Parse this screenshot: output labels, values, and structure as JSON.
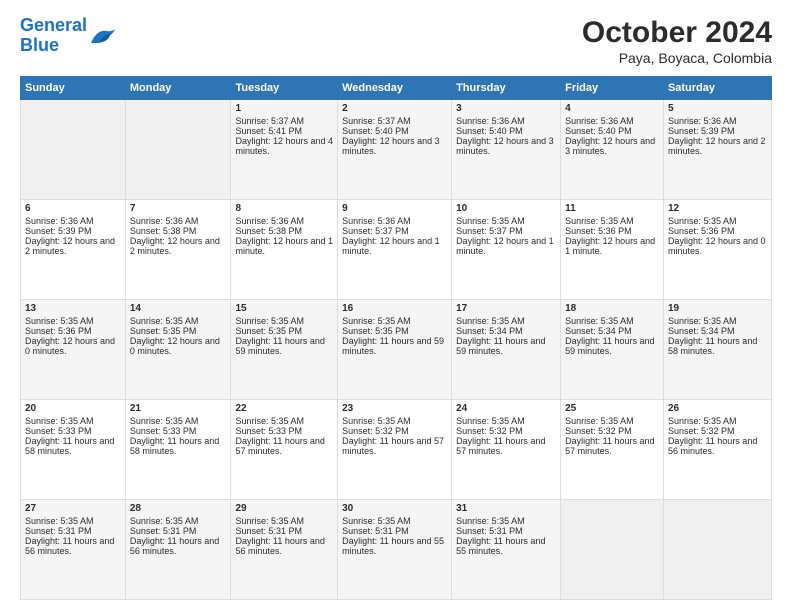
{
  "header": {
    "logo_line1": "General",
    "logo_line2": "Blue",
    "title": "October 2024",
    "subtitle": "Paya, Boyaca, Colombia"
  },
  "days_of_week": [
    "Sunday",
    "Monday",
    "Tuesday",
    "Wednesday",
    "Thursday",
    "Friday",
    "Saturday"
  ],
  "weeks": [
    [
      {
        "day": "",
        "sunrise": "",
        "sunset": "",
        "daylight": ""
      },
      {
        "day": "",
        "sunrise": "",
        "sunset": "",
        "daylight": ""
      },
      {
        "day": "1",
        "sunrise": "Sunrise: 5:37 AM",
        "sunset": "Sunset: 5:41 PM",
        "daylight": "Daylight: 12 hours and 4 minutes."
      },
      {
        "day": "2",
        "sunrise": "Sunrise: 5:37 AM",
        "sunset": "Sunset: 5:40 PM",
        "daylight": "Daylight: 12 hours and 3 minutes."
      },
      {
        "day": "3",
        "sunrise": "Sunrise: 5:36 AM",
        "sunset": "Sunset: 5:40 PM",
        "daylight": "Daylight: 12 hours and 3 minutes."
      },
      {
        "day": "4",
        "sunrise": "Sunrise: 5:36 AM",
        "sunset": "Sunset: 5:40 PM",
        "daylight": "Daylight: 12 hours and 3 minutes."
      },
      {
        "day": "5",
        "sunrise": "Sunrise: 5:36 AM",
        "sunset": "Sunset: 5:39 PM",
        "daylight": "Daylight: 12 hours and 2 minutes."
      }
    ],
    [
      {
        "day": "6",
        "sunrise": "Sunrise: 5:36 AM",
        "sunset": "Sunset: 5:39 PM",
        "daylight": "Daylight: 12 hours and 2 minutes."
      },
      {
        "day": "7",
        "sunrise": "Sunrise: 5:36 AM",
        "sunset": "Sunset: 5:38 PM",
        "daylight": "Daylight: 12 hours and 2 minutes."
      },
      {
        "day": "8",
        "sunrise": "Sunrise: 5:36 AM",
        "sunset": "Sunset: 5:38 PM",
        "daylight": "Daylight: 12 hours and 1 minute."
      },
      {
        "day": "9",
        "sunrise": "Sunrise: 5:36 AM",
        "sunset": "Sunset: 5:37 PM",
        "daylight": "Daylight: 12 hours and 1 minute."
      },
      {
        "day": "10",
        "sunrise": "Sunrise: 5:35 AM",
        "sunset": "Sunset: 5:37 PM",
        "daylight": "Daylight: 12 hours and 1 minute."
      },
      {
        "day": "11",
        "sunrise": "Sunrise: 5:35 AM",
        "sunset": "Sunset: 5:36 PM",
        "daylight": "Daylight: 12 hours and 1 minute."
      },
      {
        "day": "12",
        "sunrise": "Sunrise: 5:35 AM",
        "sunset": "Sunset: 5:36 PM",
        "daylight": "Daylight: 12 hours and 0 minutes."
      }
    ],
    [
      {
        "day": "13",
        "sunrise": "Sunrise: 5:35 AM",
        "sunset": "Sunset: 5:36 PM",
        "daylight": "Daylight: 12 hours and 0 minutes."
      },
      {
        "day": "14",
        "sunrise": "Sunrise: 5:35 AM",
        "sunset": "Sunset: 5:35 PM",
        "daylight": "Daylight: 12 hours and 0 minutes."
      },
      {
        "day": "15",
        "sunrise": "Sunrise: 5:35 AM",
        "sunset": "Sunset: 5:35 PM",
        "daylight": "Daylight: 11 hours and 59 minutes."
      },
      {
        "day": "16",
        "sunrise": "Sunrise: 5:35 AM",
        "sunset": "Sunset: 5:35 PM",
        "daylight": "Daylight: 11 hours and 59 minutes."
      },
      {
        "day": "17",
        "sunrise": "Sunrise: 5:35 AM",
        "sunset": "Sunset: 5:34 PM",
        "daylight": "Daylight: 11 hours and 59 minutes."
      },
      {
        "day": "18",
        "sunrise": "Sunrise: 5:35 AM",
        "sunset": "Sunset: 5:34 PM",
        "daylight": "Daylight: 11 hours and 59 minutes."
      },
      {
        "day": "19",
        "sunrise": "Sunrise: 5:35 AM",
        "sunset": "Sunset: 5:34 PM",
        "daylight": "Daylight: 11 hours and 58 minutes."
      }
    ],
    [
      {
        "day": "20",
        "sunrise": "Sunrise: 5:35 AM",
        "sunset": "Sunset: 5:33 PM",
        "daylight": "Daylight: 11 hours and 58 minutes."
      },
      {
        "day": "21",
        "sunrise": "Sunrise: 5:35 AM",
        "sunset": "Sunset: 5:33 PM",
        "daylight": "Daylight: 11 hours and 58 minutes."
      },
      {
        "day": "22",
        "sunrise": "Sunrise: 5:35 AM",
        "sunset": "Sunset: 5:33 PM",
        "daylight": "Daylight: 11 hours and 57 minutes."
      },
      {
        "day": "23",
        "sunrise": "Sunrise: 5:35 AM",
        "sunset": "Sunset: 5:32 PM",
        "daylight": "Daylight: 11 hours and 57 minutes."
      },
      {
        "day": "24",
        "sunrise": "Sunrise: 5:35 AM",
        "sunset": "Sunset: 5:32 PM",
        "daylight": "Daylight: 11 hours and 57 minutes."
      },
      {
        "day": "25",
        "sunrise": "Sunrise: 5:35 AM",
        "sunset": "Sunset: 5:32 PM",
        "daylight": "Daylight: 11 hours and 57 minutes."
      },
      {
        "day": "26",
        "sunrise": "Sunrise: 5:35 AM",
        "sunset": "Sunset: 5:32 PM",
        "daylight": "Daylight: 11 hours and 56 minutes."
      }
    ],
    [
      {
        "day": "27",
        "sunrise": "Sunrise: 5:35 AM",
        "sunset": "Sunset: 5:31 PM",
        "daylight": "Daylight: 11 hours and 56 minutes."
      },
      {
        "day": "28",
        "sunrise": "Sunrise: 5:35 AM",
        "sunset": "Sunset: 5:31 PM",
        "daylight": "Daylight: 11 hours and 56 minutes."
      },
      {
        "day": "29",
        "sunrise": "Sunrise: 5:35 AM",
        "sunset": "Sunset: 5:31 PM",
        "daylight": "Daylight: 11 hours and 56 minutes."
      },
      {
        "day": "30",
        "sunrise": "Sunrise: 5:35 AM",
        "sunset": "Sunset: 5:31 PM",
        "daylight": "Daylight: 11 hours and 55 minutes."
      },
      {
        "day": "31",
        "sunrise": "Sunrise: 5:35 AM",
        "sunset": "Sunset: 5:31 PM",
        "daylight": "Daylight: 11 hours and 55 minutes."
      },
      {
        "day": "",
        "sunrise": "",
        "sunset": "",
        "daylight": ""
      },
      {
        "day": "",
        "sunrise": "",
        "sunset": "",
        "daylight": ""
      }
    ]
  ]
}
